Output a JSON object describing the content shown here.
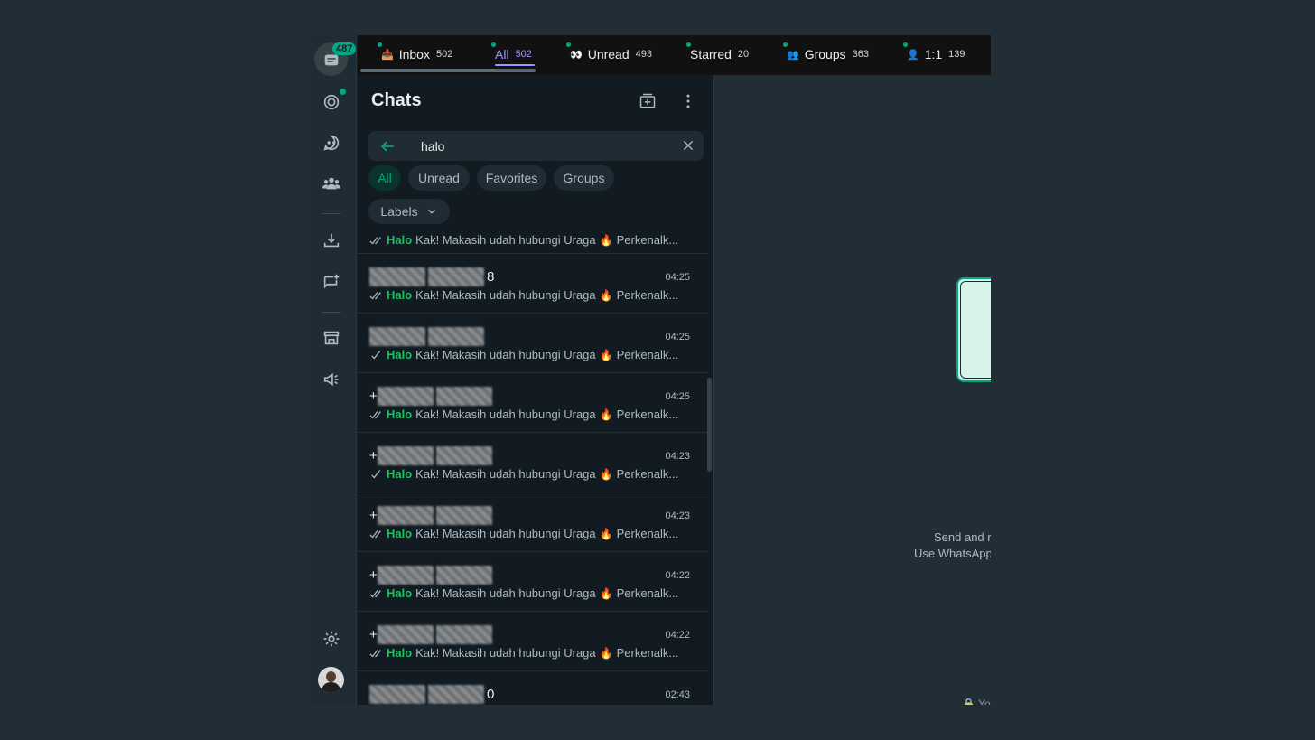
{
  "rail": {
    "chats_badge": "487"
  },
  "tabs": [
    {
      "label": "Inbox",
      "count": "502",
      "icon": "📥"
    },
    {
      "label": "All",
      "count": "502",
      "icon": ""
    },
    {
      "label": "Unread",
      "count": "493",
      "icon": "👀"
    },
    {
      "label": "Starred",
      "count": "20",
      "icon": ""
    },
    {
      "label": "Groups",
      "count": "363",
      "icon": "👥"
    },
    {
      "label": "1:1",
      "count": "139",
      "icon": "👤"
    }
  ],
  "panel": {
    "title": "Chats"
  },
  "search": {
    "value": "halo"
  },
  "filters": {
    "all": "All",
    "unread": "Unread",
    "favorites": "Favorites",
    "groups": "Groups",
    "labels": "Labels"
  },
  "preview": {
    "highlight": "Halo",
    "before_fire": "Kak! Makasih udah hubungi Uraga",
    "after_fire": "Perkenalk..."
  },
  "chats": [
    {
      "name_suffix": "8",
      "name_prefix": "",
      "time": "04:25",
      "ticks": "double"
    },
    {
      "name_suffix": "",
      "name_prefix": "",
      "time": "04:25",
      "ticks": "single"
    },
    {
      "name_suffix": "",
      "name_prefix": "+",
      "time": "04:25",
      "ticks": "double"
    },
    {
      "name_suffix": "",
      "name_prefix": "+",
      "time": "04:23",
      "ticks": "single"
    },
    {
      "name_suffix": "",
      "name_prefix": "+",
      "time": "04:23",
      "ticks": "double"
    },
    {
      "name_suffix": "",
      "name_prefix": "+",
      "time": "04:22",
      "ticks": "double"
    },
    {
      "name_suffix": "",
      "name_prefix": "+",
      "time": "04:22",
      "ticks": "double"
    },
    {
      "name_suffix": "0",
      "name_prefix": "",
      "time": "02:43",
      "ticks": "double"
    }
  ],
  "right": {
    "line1": "Send and r",
    "line2": "Use WhatsApp",
    "encryption": "You"
  },
  "colors": {
    "accent": "#00a884",
    "tab_active": "#9b95ff"
  }
}
